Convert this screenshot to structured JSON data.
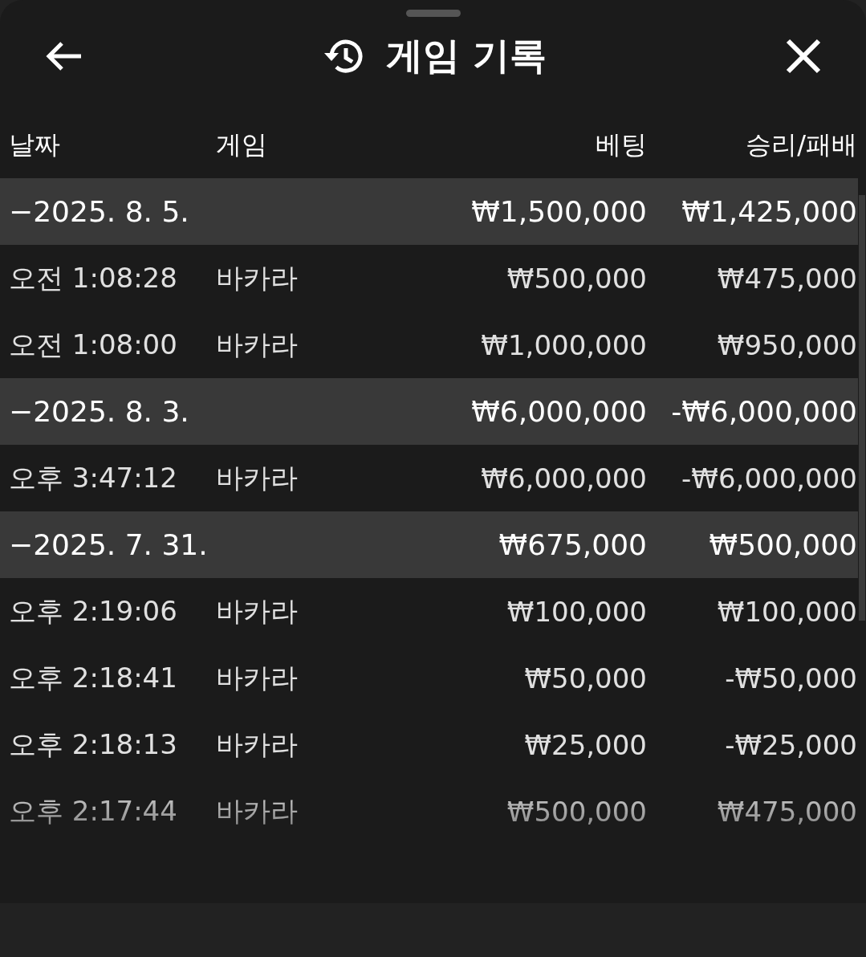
{
  "header": {
    "title": "게임 기록"
  },
  "table": {
    "columns": [
      "날짜",
      "게임",
      "베팅",
      "승리/패배"
    ],
    "groups": [
      {
        "date": "−2025. 8. 5.",
        "bet": "₩1,500,000",
        "result": "₩1,425,000",
        "rows": [
          {
            "time": "오전 1:08:28",
            "game": "바카라",
            "bet": "₩500,000",
            "result": "₩475,000"
          },
          {
            "time": "오전 1:08:00",
            "game": "바카라",
            "bet": "₩1,000,000",
            "result": "₩950,000"
          }
        ]
      },
      {
        "date": "−2025. 8. 3.",
        "bet": "₩6,000,000",
        "result": "-₩6,000,000",
        "rows": [
          {
            "time": "오후 3:47:12",
            "game": "바카라",
            "bet": "₩6,000,000",
            "result": "-₩6,000,000"
          }
        ]
      },
      {
        "date": "−2025. 7. 31.",
        "bet": "₩675,000",
        "result": "₩500,000",
        "rows": [
          {
            "time": "오후 2:19:06",
            "game": "바카라",
            "bet": "₩100,000",
            "result": "₩100,000"
          },
          {
            "time": "오후 2:18:41",
            "game": "바카라",
            "bet": "₩50,000",
            "result": "-₩50,000"
          },
          {
            "time": "오후 2:18:13",
            "game": "바카라",
            "bet": "₩25,000",
            "result": "-₩25,000"
          },
          {
            "time": "오후 2:17:44",
            "game": "바카라",
            "bet": "₩500,000",
            "result": "₩475,000"
          }
        ]
      }
    ]
  }
}
